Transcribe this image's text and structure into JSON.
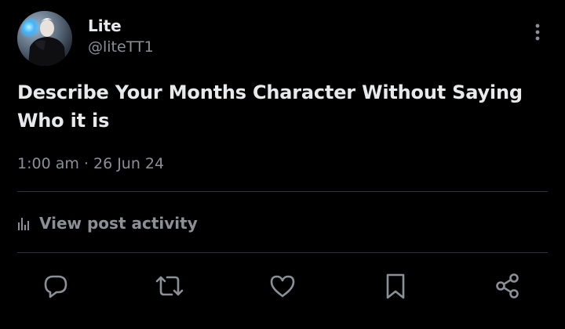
{
  "author": {
    "display_name": "Lite",
    "handle": "@liteTT1",
    "avatar_icon": "user-avatar"
  },
  "post": {
    "text": "Describe Your Months Character Without Saying Who it is",
    "timestamp": "1:00 am · 26 Jun 24"
  },
  "activity": {
    "label": "View post activity",
    "icon": "bar-chart-icon"
  },
  "actions": [
    {
      "name": "reply",
      "icon": "reply-icon"
    },
    {
      "name": "repost",
      "icon": "repost-icon"
    },
    {
      "name": "like",
      "icon": "heart-icon"
    },
    {
      "name": "bookmark",
      "icon": "bookmark-icon"
    },
    {
      "name": "share",
      "icon": "share-icon"
    }
  ],
  "colors": {
    "background": "#000000",
    "primary_text": "#e7e9ea",
    "secondary_text": "#8b9096",
    "divider": "#2f3336"
  }
}
